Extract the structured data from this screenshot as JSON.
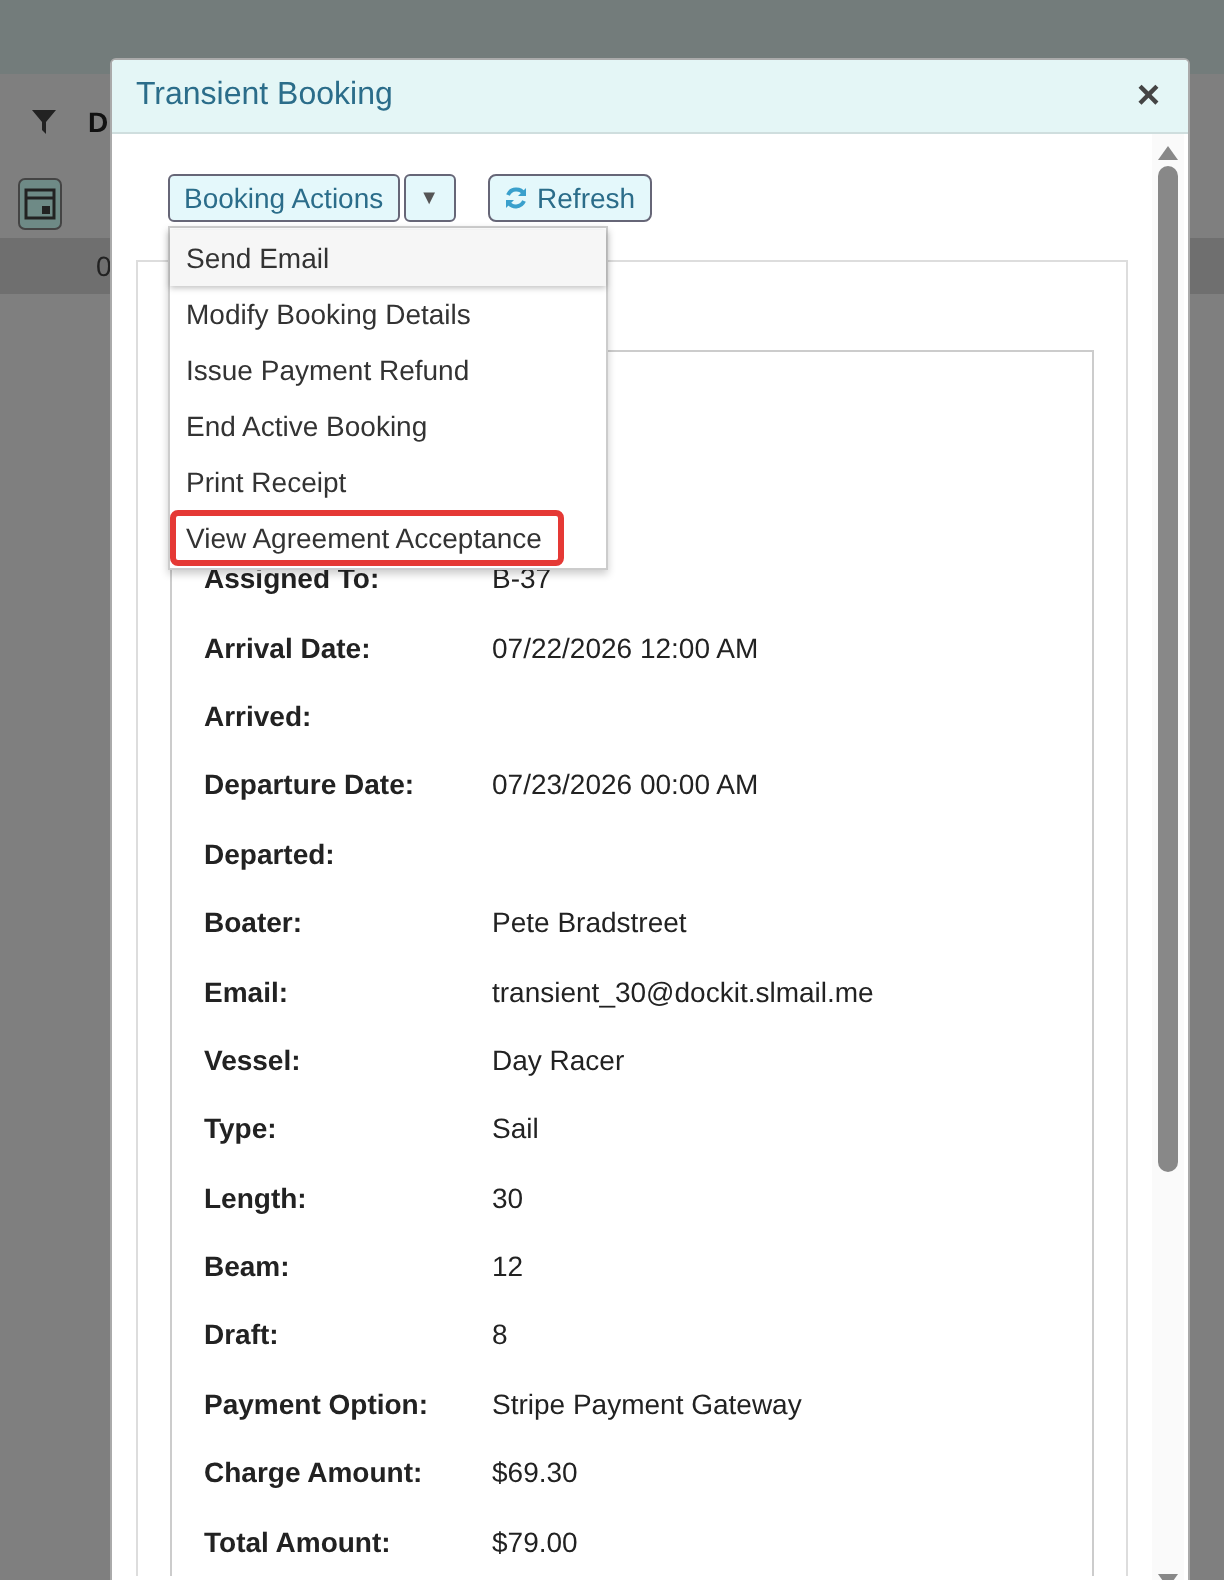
{
  "background": {
    "header_letter": "D",
    "row_letter": "0"
  },
  "dialog": {
    "title": "Transient Booking",
    "close": "×"
  },
  "toolbar": {
    "actions_button": "Booking Actions",
    "caret": "▼",
    "refresh_button": "Refresh"
  },
  "menu": [
    {
      "label": "Send Email",
      "focused": true,
      "outlined": false
    },
    {
      "label": "Modify Booking Details",
      "focused": false,
      "outlined": false
    },
    {
      "label": "Issue Payment Refund",
      "focused": false,
      "outlined": false
    },
    {
      "label": "End Active Booking",
      "focused": false,
      "outlined": false
    },
    {
      "label": "Print Receipt",
      "focused": false,
      "outlined": false
    },
    {
      "label": "View Agreement Acceptance",
      "focused": false,
      "outlined": true
    }
  ],
  "details": [
    {
      "label": "Assigned To:",
      "value": "B-37"
    },
    {
      "label": "Arrival Date:",
      "value": "07/22/2026 12:00 AM"
    },
    {
      "label": "Arrived:"
    },
    {
      "label": "Departure Date:",
      "value": "07/23/2026 00:00 AM"
    },
    {
      "label": "Departed:"
    },
    {
      "label": "Boater:",
      "value": "Pete Bradstreet"
    },
    {
      "label": "Email:",
      "value": "transient_30@dockit.slmail.me"
    },
    {
      "label": "Vessel:",
      "value": "Day Racer"
    },
    {
      "label": "Type:",
      "value": "Sail"
    },
    {
      "label": "Length:",
      "value": "30"
    },
    {
      "label": "Beam:",
      "value": "12"
    },
    {
      "label": "Draft:",
      "value": "8"
    },
    {
      "label": "Payment Option:",
      "value": "Stripe Payment Gateway"
    },
    {
      "label": "Charge Amount:",
      "value": "$69.30"
    },
    {
      "label": "Total Amount:",
      "value": "$79.00"
    }
  ]
}
